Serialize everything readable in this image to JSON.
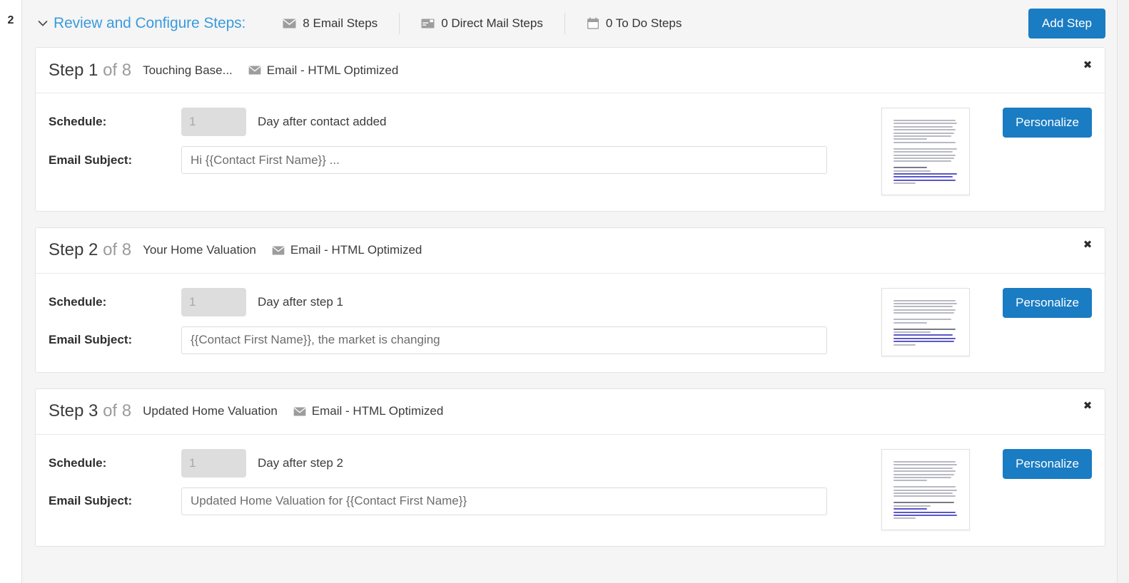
{
  "gutter": {
    "step_number": "2"
  },
  "header": {
    "chevron_icon": "chevron-down-icon",
    "title": "Review and Configure Steps:",
    "stats": [
      {
        "icon": "envelope-icon",
        "label": "8 Email Steps"
      },
      {
        "icon": "direct-mail-icon",
        "label": "0 Direct Mail Steps"
      },
      {
        "icon": "calendar-icon",
        "label": "0 To Do Steps"
      }
    ],
    "add_step_label": "Add Step"
  },
  "labels": {
    "schedule": "Schedule:",
    "email_subject": "Email Subject:",
    "personalize": "Personalize",
    "close": "✖",
    "step_word": "Step",
    "of_word": "of"
  },
  "colors": {
    "accent_blue": "#1a7cc2",
    "link_blue": "#3a9bdc",
    "panel_bg": "#f5f5f5",
    "card_bg": "#ffffff",
    "muted_text": "#9b9b9b"
  },
  "steps": [
    {
      "index": "1",
      "total": "8",
      "step_heading": "Step 1",
      "of_total": "of 8",
      "name": "Touching Base...",
      "type_icon": "envelope-icon",
      "type": "Email - HTML Optimized",
      "schedule_value": "",
      "schedule_placeholder": "1",
      "schedule_after": "Day after contact added",
      "subject_value": "Hi {{Contact First Name}} ...",
      "subject_placeholder": "Hi {{Contact First Name}} ...",
      "thumbnail_lines": 19,
      "close_label": "✖"
    },
    {
      "index": "2",
      "total": "8",
      "step_heading": "Step 2",
      "of_total": "of 8",
      "name": "Your Home Valuation",
      "type_icon": "envelope-icon",
      "type": "Email - HTML Optimized",
      "schedule_value": "",
      "schedule_placeholder": "1",
      "schedule_after": "Day after step 1",
      "subject_value": "{{Contact First Name}}, the market is changing",
      "subject_placeholder": "{{Contact First Name}}, the market is changing",
      "thumbnail_lines": 13,
      "close_label": "✖"
    },
    {
      "index": "3",
      "total": "8",
      "step_heading": "Step 3",
      "of_total": "of 8",
      "name": "Updated Home Valuation",
      "type_icon": "envelope-icon",
      "type": "Email - HTML Optimized",
      "schedule_value": "",
      "schedule_placeholder": "1",
      "schedule_after": "Day after step 2",
      "subject_value": "Updated Home Valuation for {{Contact First Name}}",
      "subject_placeholder": "Updated Home Valuation for {{Contact First Name}}",
      "thumbnail_lines": 17,
      "close_label": "✖"
    }
  ]
}
